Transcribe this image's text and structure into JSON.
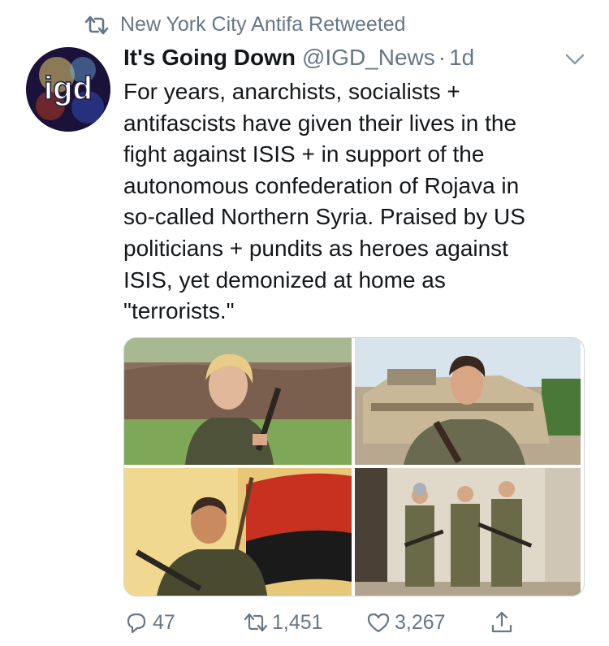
{
  "retweet_context": {
    "text": "New York City Antifa Retweeted"
  },
  "tweet": {
    "author_name": "It's Going Down",
    "author_handle": "@IGD_News",
    "separator": "·",
    "time": "1d",
    "avatar_text": "igd",
    "text": "For years, anarchists, socialists +\nantifascists have given their lives in the\nfight against ISIS + in support of the\nautonomous confederation of Rojava in\nso-called Northern Syria. Praised by US\npoliticians + pundits as heroes against\nISIS, yet demonized at home as\n\"terrorists.\""
  },
  "actions": {
    "reply_count": "47",
    "retweet_count": "1,451",
    "like_count": "3,267"
  },
  "icons": {
    "retweet": "retweet-icon",
    "reply": "reply-icon",
    "like": "heart-icon",
    "share": "share-icon",
    "caret": "chevron-down-icon"
  },
  "colors": {
    "text": "#14171a",
    "secondary": "#657786",
    "border": "#ccd6dd"
  }
}
